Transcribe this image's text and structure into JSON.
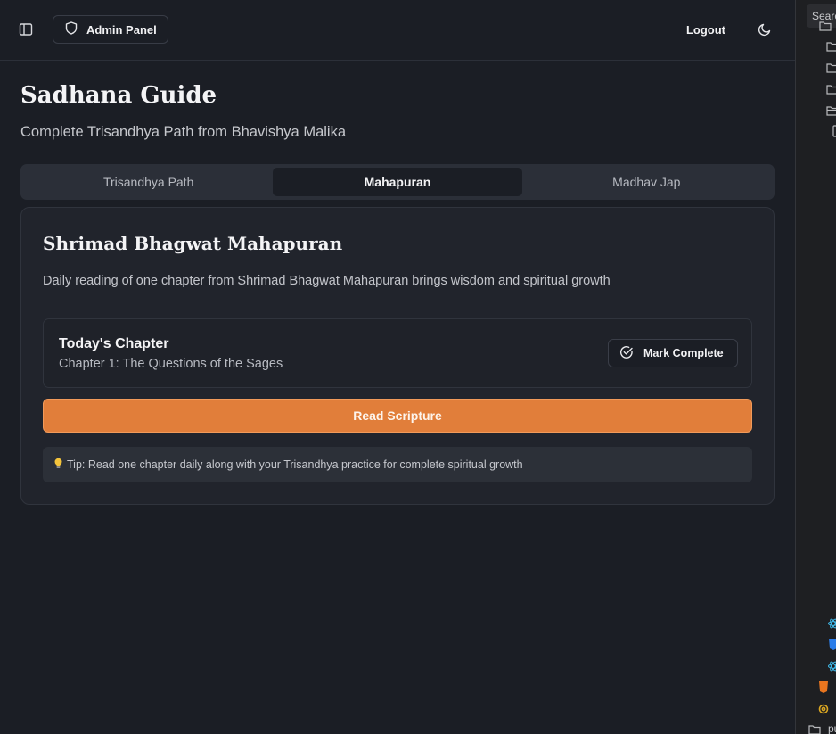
{
  "header": {
    "admin_label": "Admin Panel",
    "logout_label": "Logout"
  },
  "page": {
    "title": "Sadhana Guide",
    "subtitle": "Complete Trisandhya Path from Bhavishya Malika"
  },
  "tabs": [
    {
      "label": "Trisandhya Path",
      "active": false
    },
    {
      "label": "Mahapuran",
      "active": true
    },
    {
      "label": "Madhav Jap",
      "active": false
    }
  ],
  "card": {
    "title": "Shrimad Bhagwat Mahapuran",
    "description": "Daily reading of one chapter from Shrimad Bhagwat Mahapuran brings wisdom and spiritual growth",
    "chapter_heading": "Today's Chapter",
    "chapter_name": "Chapter 1: The Questions of the Sages",
    "mark_complete_label": "Mark Complete",
    "read_label": "Read Scripture",
    "tip_text": "Tip: Read one chapter daily along with your Trisandhya practice for complete spiritual growth"
  },
  "side_pane": {
    "search_placeholder": "Search",
    "partial_label": "pu"
  },
  "colors": {
    "background": "#1b1e25",
    "accent": "#e17e3a",
    "card": "#21242c"
  }
}
